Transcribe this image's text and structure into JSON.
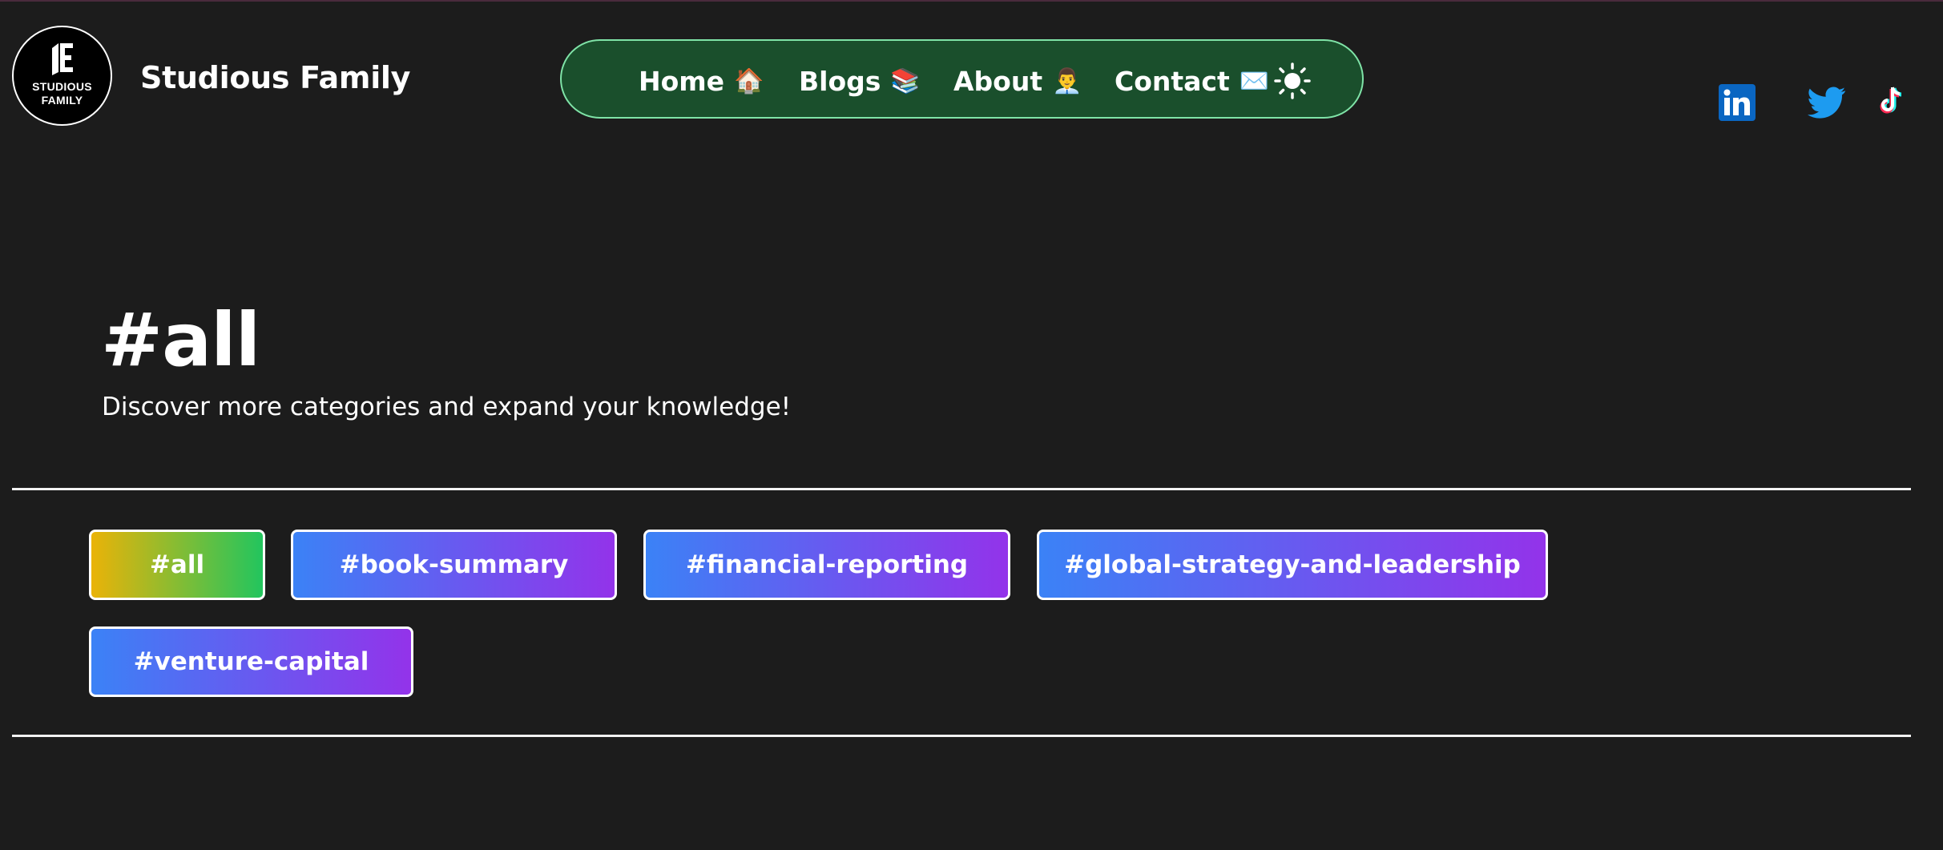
{
  "header": {
    "logo_text_line1": "STUDIOUS",
    "logo_text_line2": "FAMILY",
    "brand_name": "Studious Family"
  },
  "nav": {
    "items": [
      {
        "label": "Home",
        "emoji": "🏠"
      },
      {
        "label": "Blogs",
        "emoji": "📚"
      },
      {
        "label": "About",
        "emoji": "👨‍💼"
      },
      {
        "label": "Contact",
        "emoji": "✉️"
      }
    ],
    "theme_toggle_icon": "sun-icon"
  },
  "social": {
    "icons": [
      "linkedin-icon",
      "twitter-icon",
      "tiktok-icon"
    ]
  },
  "main": {
    "title": "#all",
    "subtitle": "Discover more categories and expand your knowledge!"
  },
  "tags": [
    {
      "label": "#all",
      "active": true
    },
    {
      "label": "#book-summary",
      "active": false
    },
    {
      "label": "#financial-reporting",
      "active": false
    },
    {
      "label": "#global-strategy-and-leadership",
      "active": false
    },
    {
      "label": "#venture-capital",
      "active": false
    }
  ],
  "colors": {
    "background": "#1c1c1c",
    "nav_background": "#1a4f2c",
    "nav_border": "#7fe3a7",
    "tag_gradient_start": "#3b82f6",
    "tag_gradient_end": "#9333ea",
    "active_tag_gradient_start": "#eab308",
    "active_tag_gradient_end": "#22c55e",
    "linkedin_blue": "#0a66c2",
    "twitter_blue": "#1d9bf0"
  }
}
